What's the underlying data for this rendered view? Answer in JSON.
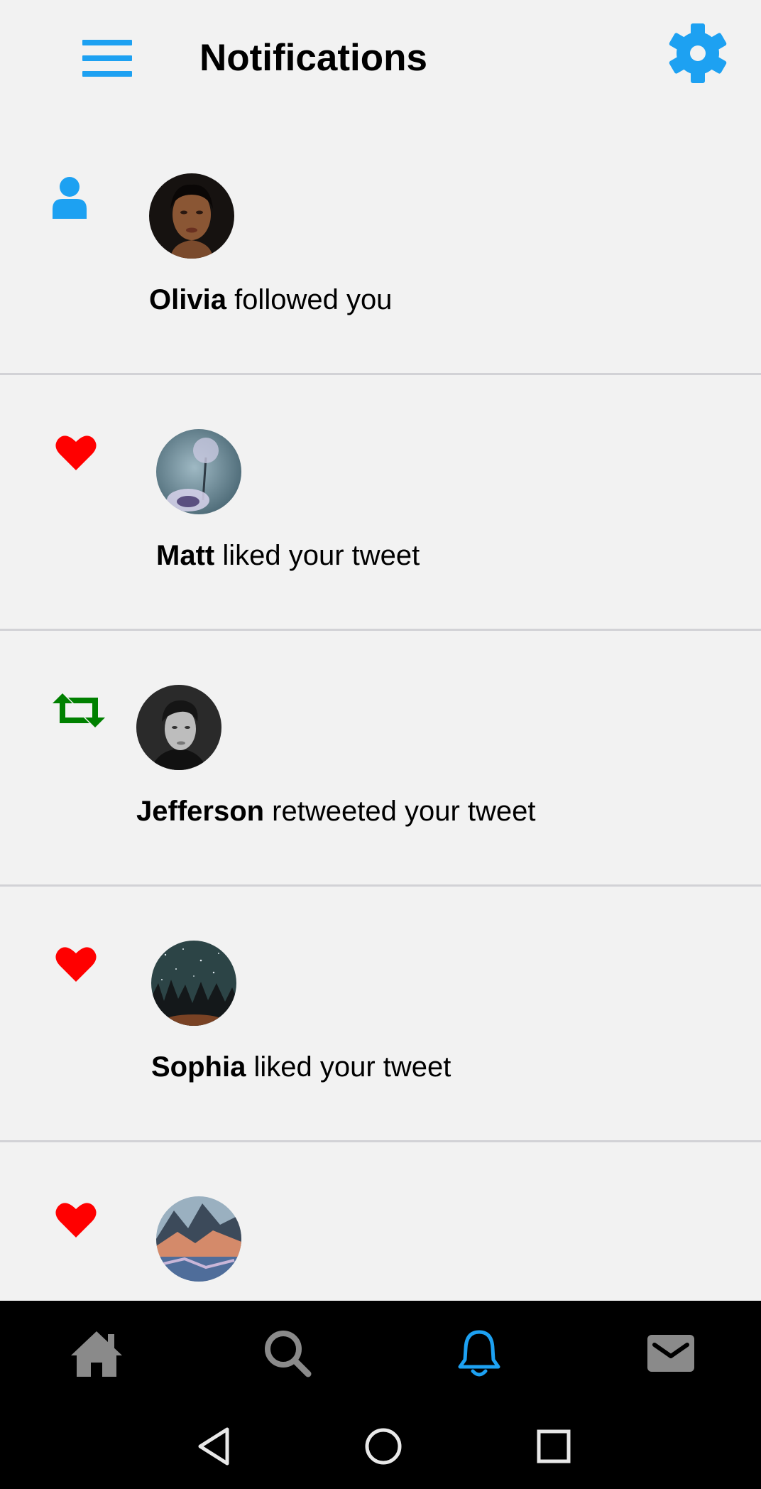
{
  "header": {
    "title": "Notifications",
    "menu_icon": "hamburger-menu-icon",
    "settings_icon": "gear-icon",
    "accent_color": "#1da1f2"
  },
  "notifications": [
    {
      "type": "follow",
      "type_icon": "person-icon",
      "icon_color": "#1da1f2",
      "name": "Olivia",
      "action": " followed you"
    },
    {
      "type": "like",
      "type_icon": "heart-icon",
      "icon_color": "#ff0000",
      "name": "Matt",
      "action": " liked your tweet"
    },
    {
      "type": "retweet",
      "type_icon": "retweet-icon",
      "icon_color": "#008000",
      "name": "Jefferson",
      "action": " retweeted your tweet"
    },
    {
      "type": "like",
      "type_icon": "heart-icon",
      "icon_color": "#ff0000",
      "name": "Sophia",
      "action": " liked your tweet"
    },
    {
      "type": "like",
      "type_icon": "heart-icon",
      "icon_color": "#ff0000",
      "name": "",
      "action": ""
    }
  ],
  "tabbar": {
    "tabs": [
      {
        "icon": "home-icon",
        "active": false
      },
      {
        "icon": "search-icon",
        "active": false
      },
      {
        "icon": "bell-icon",
        "active": true
      },
      {
        "icon": "mail-icon",
        "active": false
      }
    ],
    "active_color": "#1da1f2",
    "inactive_color": "#8a8a8a"
  },
  "system_nav": [
    "back-icon",
    "home-circle-icon",
    "recents-icon"
  ]
}
